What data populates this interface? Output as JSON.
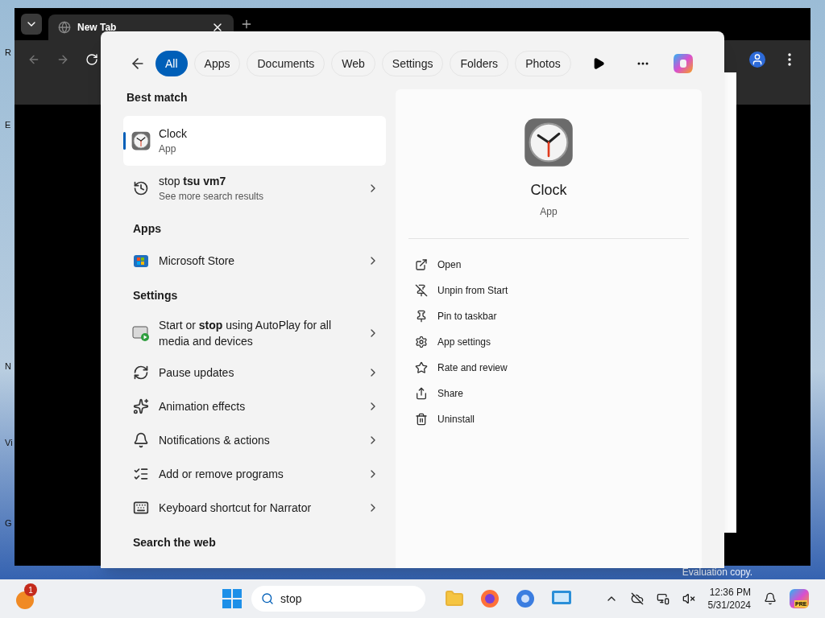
{
  "desktop": {
    "icon_labels": [
      "R",
      "E",
      "N",
      "Vi",
      "G"
    ],
    "watermark": "Evaluation copy."
  },
  "browser": {
    "tab_title": "New Tab"
  },
  "search_panel": {
    "filters": [
      {
        "label": "All",
        "selected": true
      },
      {
        "label": "Apps",
        "selected": false
      },
      {
        "label": "Documents",
        "selected": false
      },
      {
        "label": "Web",
        "selected": false
      },
      {
        "label": "Settings",
        "selected": false
      },
      {
        "label": "Folders",
        "selected": false
      },
      {
        "label": "Photos",
        "selected": false
      }
    ],
    "results": [
      {
        "kind": "header",
        "title": "Best match"
      },
      {
        "kind": "best",
        "title": "Clock",
        "subtitle": "App",
        "selected": true
      },
      {
        "kind": "row",
        "title": "stop **tsu vm7**",
        "subtitle": "See more search results",
        "selected": false
      },
      {
        "kind": "header",
        "title": "Apps"
      },
      {
        "kind": "row",
        "title": "Microsoft Store",
        "selected": false
      },
      {
        "kind": "header",
        "title": "Settings"
      },
      {
        "kind": "row",
        "title": "Start or **stop** using AutoPlay for all media and devices",
        "selected": false
      },
      {
        "kind": "row",
        "title": "Pause updates",
        "selected": false
      },
      {
        "kind": "row",
        "title": "Animation effects",
        "selected": false
      },
      {
        "kind": "row",
        "title": "Notifications & actions",
        "selected": false
      },
      {
        "kind": "row",
        "title": "Add or remove programs",
        "selected": false
      },
      {
        "kind": "row",
        "title": "Keyboard shortcut for Narrator",
        "selected": false
      },
      {
        "kind": "header",
        "title": "Search the web"
      }
    ],
    "detail": {
      "title": "Clock",
      "subtitle": "App",
      "actions": [
        "Open",
        "Unpin from Start",
        "Pin to taskbar",
        "App settings",
        "Rate and review",
        "Share",
        "Uninstall"
      ]
    }
  },
  "taskbar": {
    "badge": "1",
    "search_value": "stop",
    "time": "12:36 PM",
    "date": "5/31/2024",
    "copilot_badge": "PRE"
  }
}
